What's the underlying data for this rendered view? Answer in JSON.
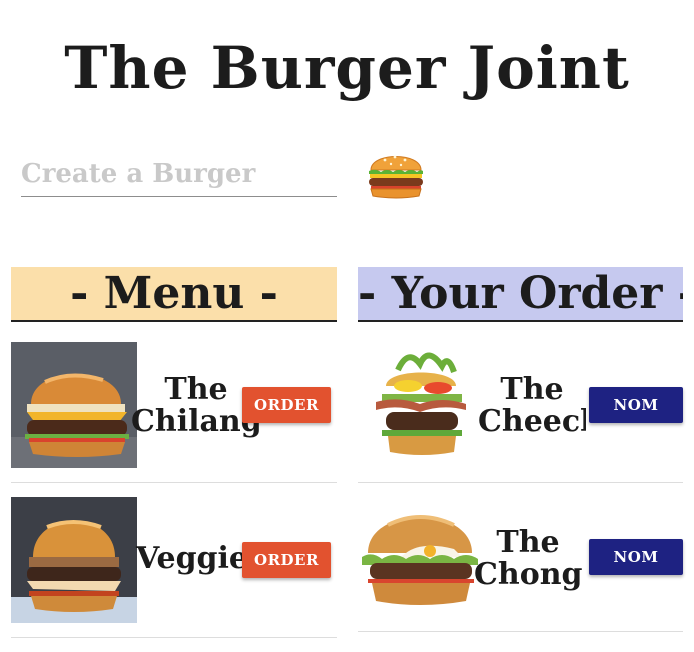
{
  "header": {
    "title": "The Burger Joint"
  },
  "create": {
    "placeholder": "Create a Burger",
    "value": ""
  },
  "menu": {
    "title": "- Menu -",
    "order_label": "ORDER",
    "items": [
      {
        "name": "The Chilango"
      },
      {
        "name": "Veggie"
      }
    ]
  },
  "order": {
    "title": "- Your Order -",
    "nom_label": "NOM",
    "items": [
      {
        "name": "The Cheech"
      },
      {
        "name": "The Chong"
      }
    ]
  },
  "colors": {
    "menu_header_bg": "#fbdfaa",
    "order_header_bg": "#c6c9ef",
    "order_button": "#e2522f",
    "nom_button": "#1e2282"
  }
}
